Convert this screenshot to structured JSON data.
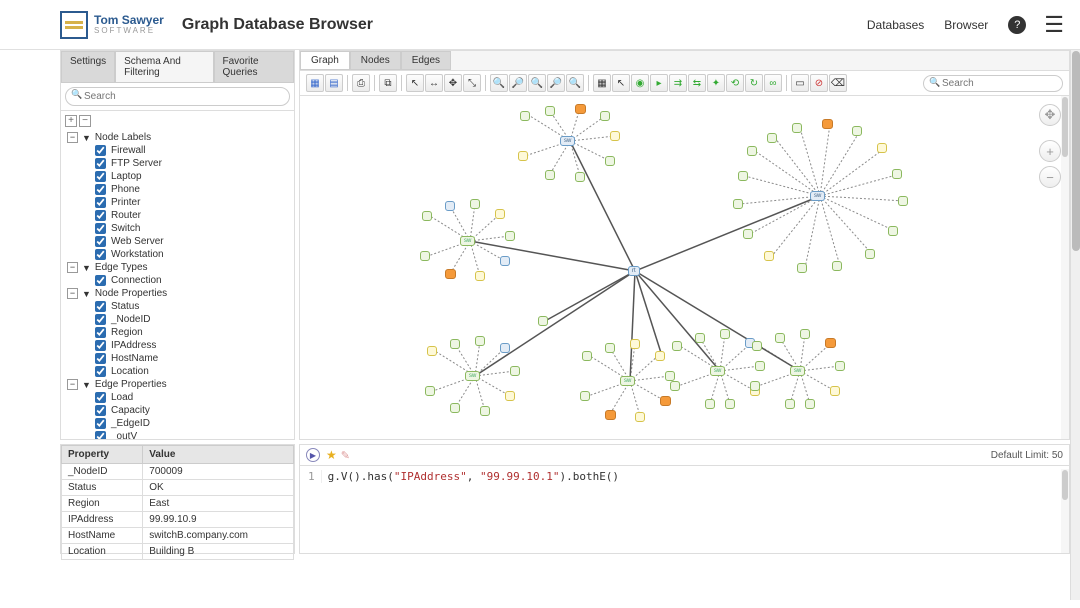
{
  "header": {
    "logo_line1": "Tom Sawyer",
    "logo_line2": "SOFTWARE",
    "app_title": "Graph Database Browser",
    "link_databases": "Databases",
    "link_browser": "Browser",
    "help_label": "?"
  },
  "left_panel": {
    "tabs": {
      "settings": "Settings",
      "schema": "Schema And Filtering",
      "favorites": "Favorite Queries"
    },
    "search_placeholder": "Search",
    "groups": {
      "node_labels": {
        "title": "Node Labels",
        "items": [
          "Firewall",
          "FTP Server",
          "Laptop",
          "Phone",
          "Printer",
          "Router",
          "Switch",
          "Web Server",
          "Workstation"
        ]
      },
      "edge_types": {
        "title": "Edge Types",
        "items": [
          "Connection"
        ]
      },
      "node_props": {
        "title": "Node Properties",
        "items": [
          "Status",
          "_NodeID",
          "Region",
          "IPAddress",
          "HostName",
          "Location"
        ]
      },
      "edge_props": {
        "title": "Edge Properties",
        "items": [
          "Load",
          "Capacity",
          "_EdgeID",
          "_outV"
        ]
      }
    }
  },
  "graph_panel": {
    "tabs": {
      "graph": "Graph",
      "nodes": "Nodes",
      "edges": "Edges"
    },
    "search_placeholder": "Search"
  },
  "properties_table": {
    "header_prop": "Property",
    "header_val": "Value",
    "rows": [
      {
        "p": "_NodeID",
        "v": "700009"
      },
      {
        "p": "Status",
        "v": "OK"
      },
      {
        "p": "Region",
        "v": "East"
      },
      {
        "p": "IPAddress",
        "v": "99.99.10.9"
      },
      {
        "p": "HostName",
        "v": "switchB.company.com"
      },
      {
        "p": "Location",
        "v": "Building B"
      }
    ]
  },
  "query_panel": {
    "default_limit_label": "Default Limit: 50",
    "line_num": "1",
    "query_prefix": "g.V().has(",
    "query_arg1": "\"IPAddress\"",
    "query_mid": ", ",
    "query_arg2": "\"99.99.10.1\"",
    "query_suffix": ").bothE()"
  }
}
